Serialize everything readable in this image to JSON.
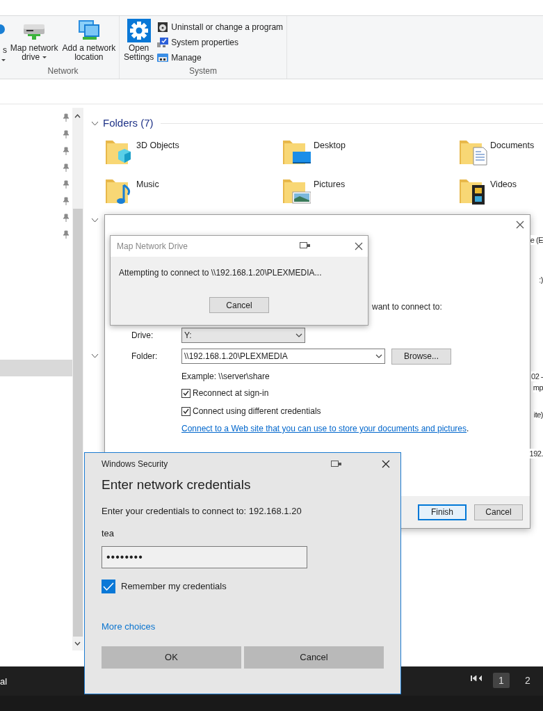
{
  "ribbon": {
    "partial_item": {
      "label": "s",
      "dropdown": true
    },
    "groups": [
      {
        "label": "Network",
        "kind": "network",
        "buttons": [
          {
            "lines": [
              "Map network",
              "drive"
            ],
            "kind": "drive",
            "dropdown": true
          },
          {
            "lines": [
              "Add a network",
              "location"
            ],
            "kind": "location",
            "dropdown": false
          }
        ]
      },
      {
        "label": "System",
        "kind": "system",
        "buttons": [
          {
            "lines": [
              "Open",
              "Settings"
            ],
            "kind": "settings",
            "dropdown": false
          }
        ],
        "small_items": [
          {
            "label": "Uninstall or change a program",
            "kind": "disc"
          },
          {
            "label": "System properties",
            "kind": "monitor"
          },
          {
            "label": "Manage",
            "kind": "manage"
          }
        ]
      }
    ]
  },
  "folders": {
    "header": "Folders (7)",
    "expanded": true,
    "items": [
      {
        "name": "3D Objects",
        "kind": "cube"
      },
      {
        "name": "Desktop",
        "kind": "desktop"
      },
      {
        "name": "Documents",
        "kind": "documents"
      },
      {
        "name": "Music",
        "kind": "music"
      },
      {
        "name": "Pictures",
        "kind": "pictures"
      },
      {
        "name": "Videos",
        "kind": "videos"
      }
    ]
  },
  "edge_texts": [
    "e (E",
    ":)",
    "02 -",
    "mp",
    "ite)",
    "192."
  ],
  "map_drive": {
    "prompt_tail": "want to connect to:",
    "drive": {
      "label": "Drive:",
      "value": "Y:"
    },
    "folder": {
      "label": "Folder:",
      "value": "\\\\192.168.1.20\\PLEXMEDIA"
    },
    "browse": "Browse...",
    "example": "Example: \\\\server\\share",
    "options": [
      {
        "label": "Reconnect at sign-in",
        "checked": true
      },
      {
        "label": "Connect using different credentials",
        "checked": true
      }
    ],
    "link": "Connect to a Web site that you can use to store your documents and pictures",
    "link_tail": ".",
    "buttons": [
      {
        "label": "Finish",
        "default": true
      },
      {
        "label": "Cancel",
        "default": false
      }
    ]
  },
  "progress": {
    "title": "Map Network Drive",
    "message": "Attempting to connect to \\\\192.168.1.20\\PLEXMEDIA...",
    "cancel": "Cancel"
  },
  "security": {
    "title": "Windows Security",
    "heading": "Enter network credentials",
    "prompt": "Enter your credentials to connect to: 192.168.1.20",
    "username": "tea",
    "password": "••••••••",
    "remember": {
      "label": "Remember my credentials",
      "checked": true
    },
    "more": "More choices",
    "buttons": [
      "OK",
      "Cancel"
    ]
  },
  "footer": {
    "left_text": "al",
    "pages": [
      {
        "label": "1",
        "selected": true
      },
      {
        "label": "2",
        "selected": false
      }
    ]
  }
}
